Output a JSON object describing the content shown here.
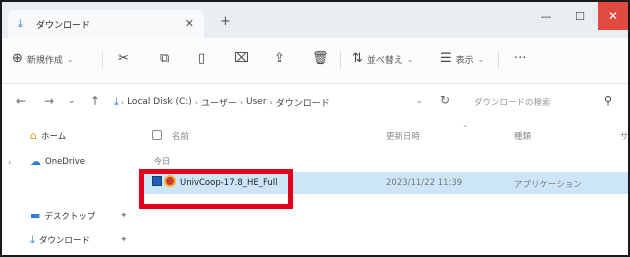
{
  "tab": {
    "title": "ダウンロード",
    "close": "✕",
    "new_tab": "+"
  },
  "window": {
    "minimize": "—",
    "maximize": "☐",
    "close": "✕"
  },
  "toolbar": {
    "new_label": "新規作成",
    "cut": "✂",
    "copy": "⧉",
    "paste": "▯",
    "rename": "⌧",
    "share": "⇪",
    "delete": "🗑",
    "sort_label": "並べ替え",
    "view_label": "表示",
    "more": "···"
  },
  "address": {
    "crumbs": [
      "Local Disk (C:)",
      "ユーザー",
      "User",
      "ダウンロード"
    ],
    "search_placeholder": "ダウンロードの検索"
  },
  "sidebar": {
    "items": [
      {
        "label": "ホーム",
        "icon": "home-icon"
      },
      {
        "label": "OneDrive",
        "icon": "cloud-icon"
      },
      {
        "label": "デスクトップ",
        "icon": "desktop-icon"
      },
      {
        "label": "ダウンロード",
        "icon": "download-icon"
      }
    ]
  },
  "columns": {
    "name": "名前",
    "date": "更新日時",
    "type": "種類",
    "size": "サ"
  },
  "group": {
    "label": "今日"
  },
  "files": [
    {
      "name": "UnivCoop-17.8_HE_Full",
      "date": "2023/11/22 11:39",
      "type": "アプリケーション"
    }
  ],
  "colors": {
    "highlight": "#e3001b",
    "selection": "#cde6f7",
    "close": "#e04a3f"
  }
}
